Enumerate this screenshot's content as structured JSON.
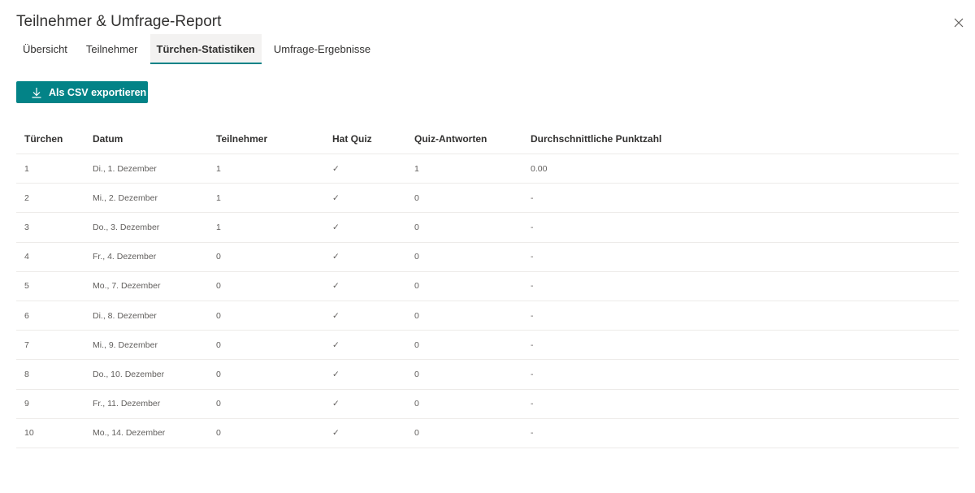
{
  "dialog": {
    "title": "Teilnehmer & Umfrage-Report",
    "close_icon": "close-icon"
  },
  "tabs": [
    {
      "label": "Übersicht",
      "active": false
    },
    {
      "label": "Teilnehmer",
      "active": false
    },
    {
      "label": "Türchen-Statistiken",
      "active": true
    },
    {
      "label": "Umfrage-Ergebnisse",
      "active": false
    }
  ],
  "toolbar": {
    "export_label": "Als CSV exportieren",
    "export_icon": "download-icon"
  },
  "colors": {
    "accent": "#038387",
    "text": "#323130",
    "muted": "#605e5c",
    "divider": "#edebe9"
  },
  "table": {
    "headers": [
      "Türchen",
      "Datum",
      "Teilnehmer",
      "Hat Quiz",
      "Quiz-Antworten",
      "Durchschnittliche Punktzahl"
    ],
    "rows": [
      [
        "1",
        "Di., 1. Dezember",
        "1",
        "✓",
        "1",
        "0.00"
      ],
      [
        "2",
        "Mi., 2. Dezember",
        "1",
        "✓",
        "0",
        "-"
      ],
      [
        "3",
        "Do., 3. Dezember",
        "1",
        "✓",
        "0",
        "-"
      ],
      [
        "4",
        "Fr., 4. Dezember",
        "0",
        "✓",
        "0",
        "-"
      ],
      [
        "5",
        "Mo., 7. Dezember",
        "0",
        "✓",
        "0",
        "-"
      ],
      [
        "6",
        "Di., 8. Dezember",
        "0",
        "✓",
        "0",
        "-"
      ],
      [
        "7",
        "Mi., 9. Dezember",
        "0",
        "✓",
        "0",
        "-"
      ],
      [
        "8",
        "Do., 10. Dezember",
        "0",
        "✓",
        "0",
        "-"
      ],
      [
        "9",
        "Fr., 11. Dezember",
        "0",
        "✓",
        "0",
        "-"
      ],
      [
        "10",
        "Mo., 14. Dezember",
        "0",
        "✓",
        "0",
        "-"
      ]
    ]
  }
}
